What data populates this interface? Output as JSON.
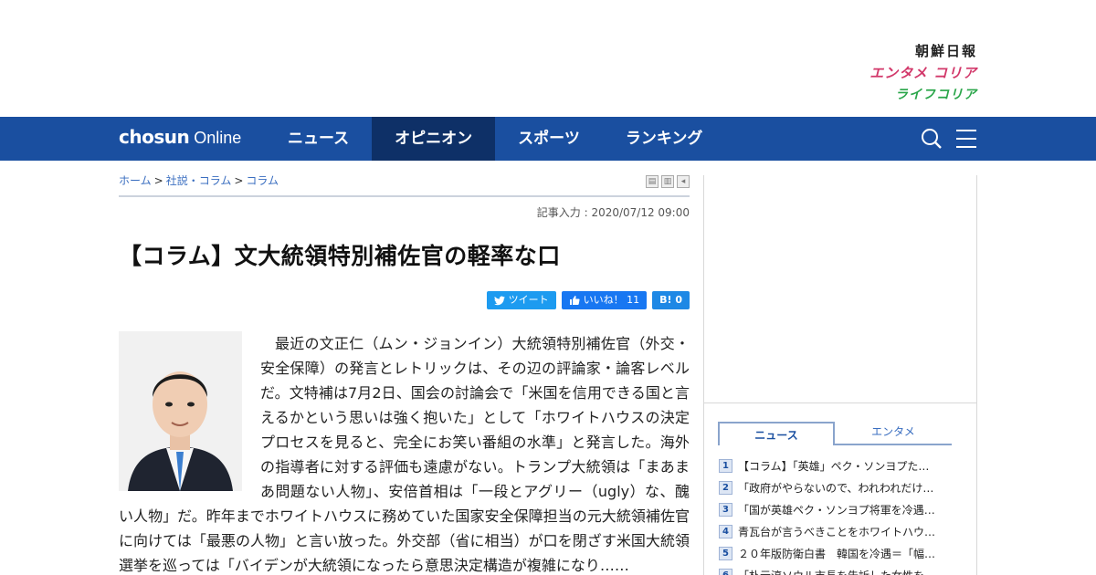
{
  "brands": [
    "朝鮮日報",
    "エンタメ コリア",
    "ライフコリア"
  ],
  "nav": {
    "logo_bold": "chosun",
    "logo_light": " Online",
    "items": [
      {
        "label": "ニュース",
        "active": false
      },
      {
        "label": "オピニオン",
        "active": true
      },
      {
        "label": "スポーツ",
        "active": false
      },
      {
        "label": "ランキング",
        "active": false
      }
    ]
  },
  "breadcrumb": [
    "ホーム",
    "社説・コラム",
    "コラム"
  ],
  "article": {
    "date": "記事入力 : 2020/07/12 09:00",
    "title": "【コラム】文大統領特別補佐官の軽率な口",
    "tweet_label": "ツイート",
    "like_label": "いいね！ 11",
    "hatena_label": "B! 0",
    "body": "最近の文正仁（ムン・ジョンイン）大統領特別補佐官（外交・安全保障）の発言とレトリックは、その辺の評論家・論客レベルだ。文特補は7月2日、国会の討論会で「米国を信用できる国と言えるかという思いは強く抱いた」として「ホワイトハウスの決定プロセスを見ると、完全にお笑い番組の水準」と発言した。海外の指導者に対する評価も遠慮がない。トランプ大統領は「まあまあ問題ない人物」、安倍首相は「一段とアグリー（ugly）な、醜い人物」だ。昨年までホワイトハウスに務めていた国家安全保障担当の元大統領補佐官に向けては「最悪の人物」と言い放った。外交部（省に相当）が口を閉ざす米国大統領選挙を巡っては「バイデンが大統領になったら意思決定構造が複雑になり……"
  },
  "sidebar": {
    "tabs": [
      "ニュース",
      "エンタメ"
    ],
    "ranking": [
      {
        "num": "1",
        "title": "【コラム】「英雄」ペク・ソンヨプた…"
      },
      {
        "num": "2",
        "title": "「政府がやらないので、われわれだけ…"
      },
      {
        "num": "3",
        "title": "「国が英雄ペク・ソンヨプ将軍を冷遇…"
      },
      {
        "num": "4",
        "title": "青瓦台が言うべきことをホワイトハウ…"
      },
      {
        "num": "5",
        "title": "２０年版防衛白書　韓国を冷遇＝「幅…"
      },
      {
        "num": "6",
        "title": "「朴元淳ソウル市長を告訴した女性を…"
      }
    ]
  },
  "colors": {
    "nav": "#1a4fa0",
    "nav_active": "#0e3067"
  }
}
